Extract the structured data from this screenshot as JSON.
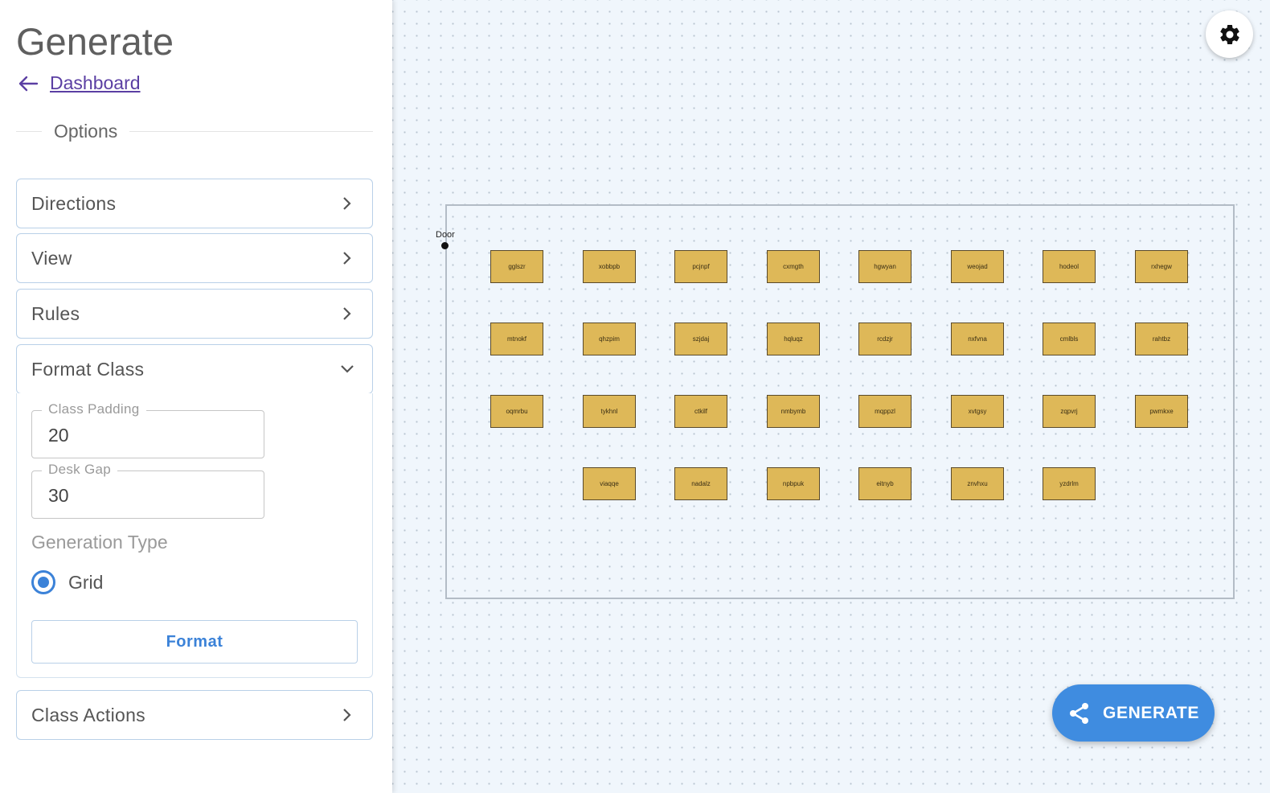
{
  "sidebar": {
    "title": "Generate",
    "back_link": "Dashboard",
    "options_label": "Options",
    "panels": {
      "directions": "Directions",
      "view": "View",
      "rules": "Rules",
      "format_class": "Format Class",
      "class_actions": "Class Actions"
    },
    "format_class": {
      "class_padding_label": "Class Padding",
      "class_padding_value": "20",
      "desk_gap_label": "Desk Gap",
      "desk_gap_value": "30",
      "generation_type_label": "Generation Type",
      "grid_option": "Grid",
      "grid_selected": true,
      "format_button": "Format"
    }
  },
  "canvas": {
    "door_label": "Door",
    "desk_rows": [
      [
        "gglszr",
        "xobbpb",
        "pcjnpf",
        "cxmgth",
        "hgwyan",
        "weojad",
        "hodeol",
        "rxhegw"
      ],
      [
        "mtnokf",
        "qhzpim",
        "szjdaj",
        "hqluqz",
        "rcdzjr",
        "nxfvna",
        "cmlbls",
        "rahtbz"
      ],
      [
        "oqmrbu",
        "tykhnl",
        "ctkilf",
        "nmbymb",
        "mqppzl",
        "xvtgsy",
        "zqpvrj",
        "pwmkxe"
      ],
      [
        "",
        "viaqqe",
        "nadalz",
        "npbpuk",
        "eitnyb",
        "znvhxu",
        "yzdrlm",
        ""
      ]
    ]
  },
  "actions": {
    "generate_label": "GENERATE",
    "settings_icon": "gear-icon"
  },
  "colors": {
    "accent": "#3f8ce0",
    "desk_fill": "#deb858",
    "link": "#5b3fa3"
  }
}
